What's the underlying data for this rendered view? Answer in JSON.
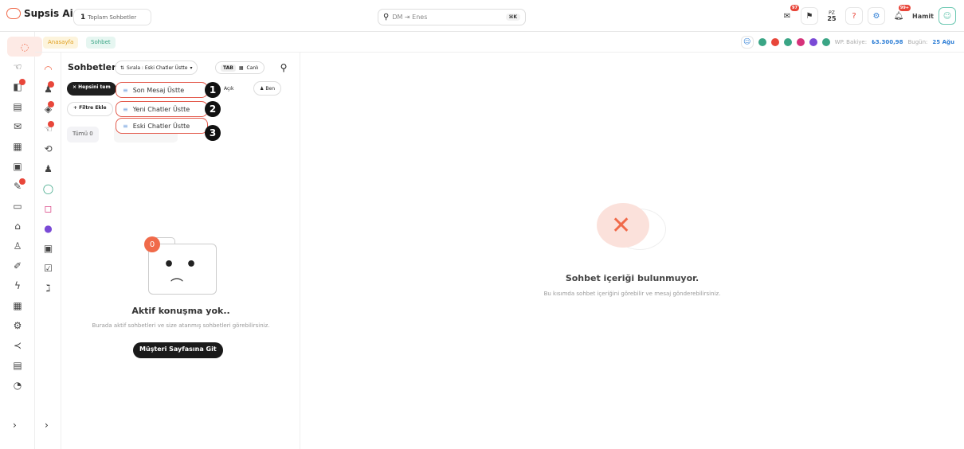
{
  "topbar": {
    "logo": "Supsis Ai",
    "chat_count": "1",
    "chat_count_label": "Toplam Sohbetler",
    "search_placeholder": "DM ⇥ Enes",
    "search_kbd": "⌘K",
    "user_name": "Hamit",
    "badges": {
      "mail": "97",
      "bell": "99+"
    },
    "date_icon": {
      "day_label": "PZ",
      "day_num": "25"
    }
  },
  "breadcrumbs": [
    "Anasayfa",
    "Sohbet"
  ],
  "status": {
    "wp_label": "WP. Bakiye:",
    "wp_value": "₺3.300,98",
    "today_label": "Bugün:",
    "today_value": "25 Ağu"
  },
  "panel": {
    "title": "Sohbetler",
    "sort_label": "Sırala : Eski Chatler Üstte",
    "tab_key": "TAB",
    "live_label": "Canlı",
    "filter_all": "Hepsini tem",
    "filter_open": "Açık",
    "filter_me": "Ben",
    "add_filter": "Filtre Ekle",
    "tab_all": "Tümü",
    "tab_all_count": "0"
  },
  "sort_dropdown": [
    {
      "label": "Son Mesaj Üstte",
      "num": "1"
    },
    {
      "label": "Yeni Chatler Üstte",
      "num": "2"
    },
    {
      "label": "Eski Chatler Üstte",
      "num": "3"
    }
  ],
  "empty_left": {
    "count": "0",
    "title": "Aktif konuşma yok..",
    "desc": "Burada aktif sohbetleri ve size atanmış sohbetleri görebilirsiniz.",
    "button": "Müşteri Sayfasına Git"
  },
  "empty_right": {
    "title": "Sohbet içeriği bulunmuyor.",
    "desc": "Bu kısımda sohbet içeriğini görebilir ve mesaj gönderebilirsiniz."
  },
  "rail_badges": {
    "r1_badge": "99+"
  },
  "colors": {
    "accent": "#f06a4a",
    "danger": "#e8463a",
    "link": "#2f7fd6"
  }
}
